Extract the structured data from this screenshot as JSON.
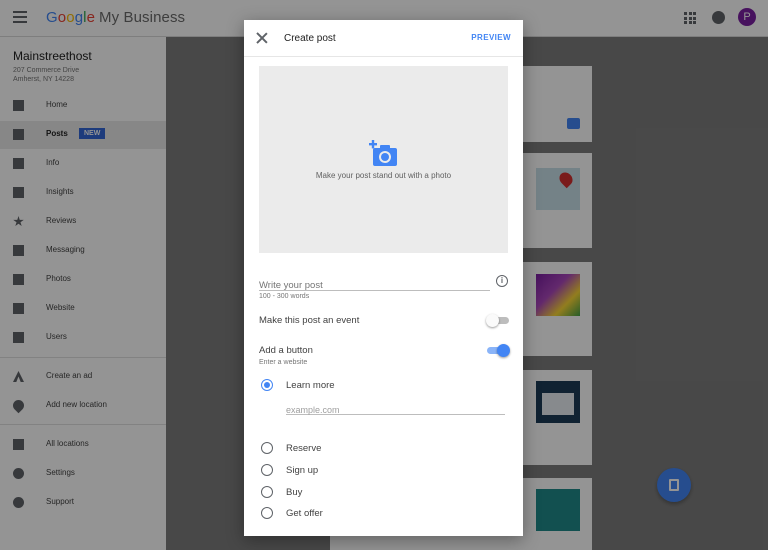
{
  "app": {
    "logo": {
      "g": "G",
      "o1": "o",
      "o2": "o",
      "g2": "g",
      "l": "l",
      "e": "e",
      "product": "My Business"
    },
    "avatar_letter": "P"
  },
  "business": {
    "name": "Mainstreethost",
    "address_line1": "207 Commerce Drive",
    "address_line2": "Amherst, NY 14228"
  },
  "sidebar": {
    "items": [
      {
        "label": "Home",
        "icon": "dashboard-icon"
      },
      {
        "label": "Posts",
        "icon": "posts-icon",
        "badge": "NEW",
        "active": true
      },
      {
        "label": "Info",
        "icon": "store-icon"
      },
      {
        "label": "Insights",
        "icon": "insights-icon"
      },
      {
        "label": "Reviews",
        "icon": "star-icon"
      },
      {
        "label": "Messaging",
        "icon": "chat-icon"
      },
      {
        "label": "Photos",
        "icon": "photos-icon"
      },
      {
        "label": "Website",
        "icon": "website-icon"
      },
      {
        "label": "Users",
        "icon": "users-icon"
      },
      {
        "label": "Create an ad",
        "icon": "ads-icon"
      },
      {
        "label": "Add new location",
        "icon": "location-pin-icon"
      },
      {
        "label": "All locations",
        "icon": "locations-icon"
      },
      {
        "label": "Settings",
        "icon": "gear-icon"
      },
      {
        "label": "Support",
        "icon": "help-icon"
      }
    ]
  },
  "dialog": {
    "title": "Create post",
    "preview_label": "PREVIEW",
    "photo_hint": "Make your post stand out with a photo",
    "post_placeholder": "Write your post",
    "word_hint": "100 - 300 words",
    "event_label": "Make this post an event",
    "event_toggle_on": false,
    "button_label": "Add a button",
    "button_toggle_on": true,
    "button_hint": "Enter a website",
    "options": [
      {
        "label": "Learn more",
        "checked": true
      },
      {
        "label": "Reserve",
        "checked": false
      },
      {
        "label": "Sign up",
        "checked": false
      },
      {
        "label": "Buy",
        "checked": false
      },
      {
        "label": "Get offer",
        "checked": false
      }
    ],
    "url_placeholder": "example.com"
  },
  "colors": {
    "accent": "#4285f4",
    "badge": "#3367d6",
    "avatar": "#7b1fa2"
  }
}
